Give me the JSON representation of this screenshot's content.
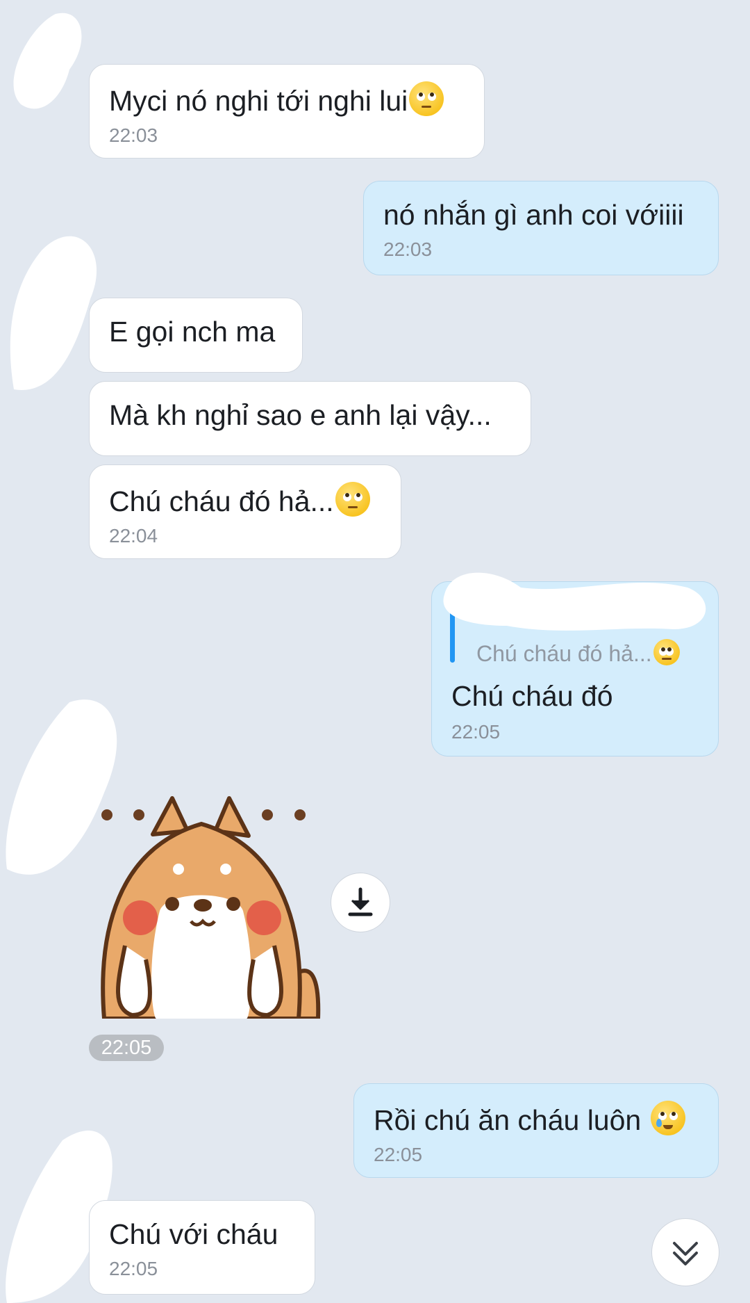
{
  "messages": {
    "m1": {
      "text": "Myci nó nghi tới nghi lui",
      "time": "22:03"
    },
    "m2": {
      "text": "nó nhắn gì anh coi vớiiii",
      "time": "22:03"
    },
    "m3": {
      "text": "E gọi nch ma"
    },
    "m4": {
      "text": "Mà kh nghỉ sao e anh lại vậy..."
    },
    "m5": {
      "text": "Chú cháu đó hả...",
      "time": "22:04"
    },
    "m6": {
      "quote": "Chú cháu đó hả...",
      "text": "Chú cháu đó",
      "time": "22:05"
    },
    "sticker": {
      "time": "22:05"
    },
    "m7": {
      "text": "Rồi chú ăn cháu luôn ",
      "time": "22:05"
    },
    "m8": {
      "text": "Chú với cháu⁣",
      "time": "22:05"
    }
  },
  "icons": {
    "emoji_m1": "face-with-rolling-eyes-icon",
    "emoji_m5": "face-with-rolling-eyes-icon",
    "emoji_m6": "face-with-rolling-eyes-icon",
    "emoji_m7": "smiling-face-with-tear-icon",
    "download": "download-icon",
    "scroll": "double-chevron-down-icon"
  },
  "colors": {
    "background": "#e2e8f0",
    "incoming_bubble": "#ffffff",
    "outgoing_bubble": "#d4edfc",
    "reply_accent": "#2196f3"
  }
}
